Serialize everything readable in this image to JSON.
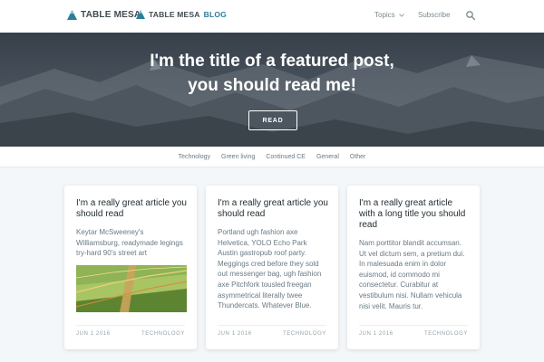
{
  "header": {
    "brand_name": "TABLE MESA",
    "brand2_name": "TABLE MESA",
    "brand2_suffix": "BLOG",
    "nav": {
      "topics": "Topics",
      "subscribe": "Subscribe"
    },
    "icons": {
      "logo": "mountain-logo-icon",
      "topics_chevron": "chevron-down-icon",
      "search": "search-icon"
    }
  },
  "hero": {
    "title_line1": "I'm the title of a featured post,",
    "title_line2": "you should read me!",
    "button": "READ"
  },
  "categories": [
    "Technology",
    "Green living",
    "Continued CE",
    "General",
    "Other"
  ],
  "cards": [
    {
      "title": "I'm a really great article you should read",
      "excerpt": "Keytar McSweeney's Williamsburg, readymade legings try-hard 90's street art",
      "image": "vineyard-image",
      "date": "JUN 1 2016",
      "category": "TECHNOLOGY"
    },
    {
      "title": "I'm a really great article you should read",
      "excerpt": "Portland ugh fashion axe Helvetica, YOLO Echo Park Austin gastropub roof party. Meggings cred before they sold out messenger bag, ugh fashion axe Pitchfork tousled freegan asymmetrical literally twee Thundercats. Whatever Blue.",
      "date": "JUN 1 2016",
      "category": "TECHNOLOGY"
    },
    {
      "title": "I'm a really great article with a long title you should read",
      "excerpt": "Nam porttitor blandit accumsan. Ut vel dictum sem, a pretium dui. In malesuada enim in dolor euismod, id commodo mi consectetur. Curabitur at vestibulum nisi. Nullam vehicula nisi velit. Mauris tur.",
      "date": "JUN 1 2016",
      "category": "TECHNOLOGY"
    }
  ],
  "colors": {
    "accent": "#2a7f9a",
    "background": "#f4f7f9",
    "card": "#ffffff"
  }
}
